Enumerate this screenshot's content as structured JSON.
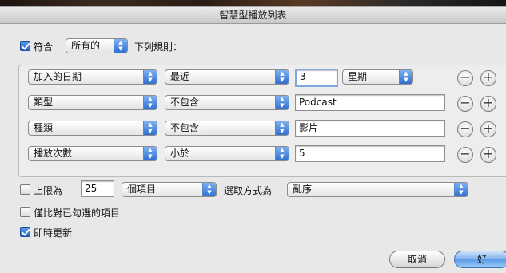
{
  "dialog": {
    "title": "智慧型播放列表"
  },
  "match": {
    "checkbox_label": "符合",
    "checked": true,
    "scope_value": "所有的",
    "suffix": "下列規則："
  },
  "rules": [
    {
      "field": "加入的日期",
      "operator": "最近",
      "value": "3",
      "unit": "星期"
    },
    {
      "field": "類型",
      "operator": "不包含",
      "value": "Podcast"
    },
    {
      "field": "種類",
      "operator": "不包含",
      "value": "影片"
    },
    {
      "field": "播放次數",
      "operator": "小於",
      "value": "5"
    }
  ],
  "rule_buttons": {
    "remove": "−",
    "add": "+"
  },
  "limit": {
    "label": "上限為",
    "checked": false,
    "value": "25",
    "unit": "個項目",
    "select_by_label": "選取方式為",
    "select_by_value": "亂序"
  },
  "checked_only": {
    "label": "僅比對已勾選的項目",
    "checked": false
  },
  "live_update": {
    "label": "即時更新",
    "checked": true
  },
  "buttons": {
    "cancel": "取消",
    "ok": "好"
  },
  "icons": {
    "popup_arrows": "updown-chevron-icon",
    "checkbox_check": "checkmark-icon"
  },
  "colors": {
    "accent": "#2f6fd0",
    "default_button": "#5d9be6"
  }
}
